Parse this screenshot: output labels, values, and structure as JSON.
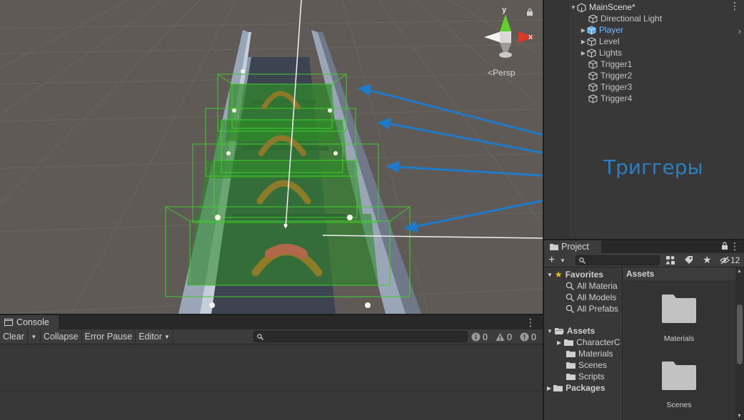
{
  "scene": {
    "view_mode_label": "Persp",
    "gizmo_axis_y": "y",
    "gizmo_axis_x": "x",
    "annotation": "Триггеры",
    "accent_color": "#2a7fc0"
  },
  "hierarchy": {
    "items": [
      {
        "label": "MainScene*",
        "icon": "unity-logo-icon"
      },
      {
        "label": "Directional Light",
        "icon": "cube-icon"
      },
      {
        "label": "Player",
        "icon": "cube-icon",
        "color": "#79b8ff"
      },
      {
        "label": "Level",
        "icon": "cube-icon"
      },
      {
        "label": "Lights",
        "icon": "cube-icon"
      },
      {
        "label": "Trigger1",
        "icon": "cube-icon"
      },
      {
        "label": "Trigger2",
        "icon": "cube-icon"
      },
      {
        "label": "Trigger3",
        "icon": "cube-icon"
      },
      {
        "label": "Trigger4",
        "icon": "cube-icon"
      }
    ]
  },
  "console": {
    "tab_label": "Console",
    "toolbar": {
      "clear": "Clear",
      "collapse": "Collapse",
      "error_pause": "Error Pause",
      "editor": "Editor"
    },
    "counts": {
      "log": "0",
      "warning": "0",
      "error": "0"
    }
  },
  "project": {
    "tab_label": "Project",
    "hidden_count": "12",
    "favorites": {
      "label": "Favorites",
      "items": [
        "All Materia",
        "All Models",
        "All Prefabs"
      ]
    },
    "assets": {
      "label": "Assets",
      "items": [
        "CharacterC",
        "Materials",
        "Scenes",
        "Scripts"
      ]
    },
    "packages_label": "Packages",
    "grid_header": "Assets",
    "grid_items": [
      "Materials",
      "Scenes"
    ]
  }
}
